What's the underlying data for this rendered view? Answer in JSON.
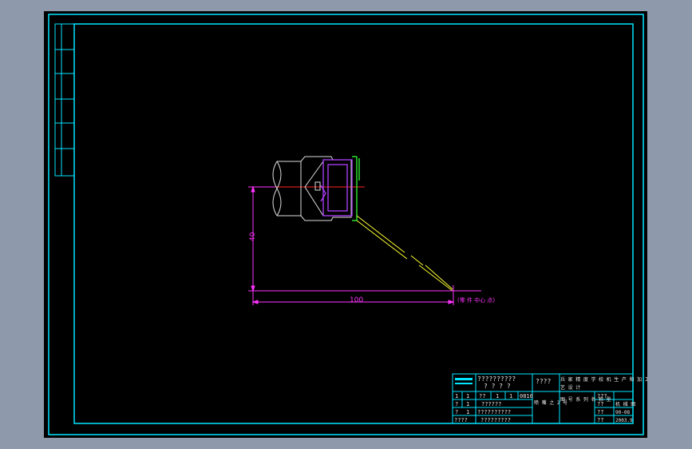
{
  "colors": {
    "frame": "#00e5ff",
    "title_text": "#e8e8e8",
    "dimension": "#ff33ff",
    "centerline": "#ff2222",
    "part": "#dddddd",
    "nozzle": "#b040ff",
    "jet": "#ffff33",
    "logo": "#00e5ff",
    "background": "#000000",
    "canvas": "#8e9aab"
  },
  "drawing": {
    "dim_vertical": "40",
    "dim_horizontal": "100",
    "note": "(零 件 中心 点)"
  },
  "title_block": {
    "row1": {
      "c1": "??????????",
      "c1b": "? ? ? ?",
      "c2": "????",
      "c3": "兵 家 精 度 学 校 机 生 产 和 加 工 工",
      "c3b": "艺 设 计"
    },
    "row2": {
      "cells": [
        "1",
        "1",
        "??",
        "1",
        "1",
        "0810"
      ],
      "c2": "喷 嘴 之 2 号",
      "c3": "图 号 系 列 名 称 型"
    },
    "row3": {
      "cells": [
        "?",
        "1",
        "??????"
      ]
    },
    "row4": {
      "cells": [
        "?",
        "1",
        "??????????"
      ]
    },
    "row5": {
      "cells": [
        "????",
        "?????????"
      ]
    },
    "right": [
      "???",
      "??",
      "??",
      "??"
    ],
    "right2": [
      "",
      "",
      "机 械 图",
      "90-08",
      "2003.9"
    ]
  }
}
